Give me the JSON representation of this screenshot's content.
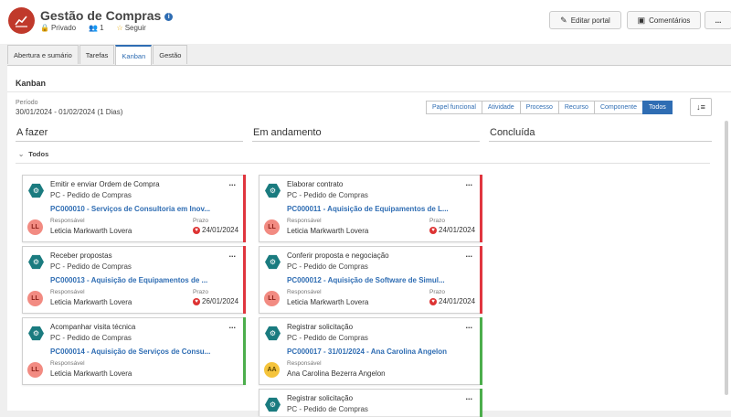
{
  "header": {
    "title": "Gestão de Compras",
    "privacy": "Privado",
    "members": "1",
    "follow": "Seguir",
    "edit_label": "Editar portal",
    "comments_label": "Comentários",
    "more_label": "...",
    "brand_color": "#c0392b"
  },
  "tabs": [
    {
      "label": "Abertura e sumário",
      "active": false
    },
    {
      "label": "Tarefas",
      "active": false
    },
    {
      "label": "Kanban",
      "active": true
    },
    {
      "label": "Gestão",
      "active": false
    }
  ],
  "kanban": {
    "title": "Kanban",
    "period_label": "Período",
    "period_value": "30/01/2024 - 01/02/2024 (1 Dias)",
    "filters": [
      "Papel funcional",
      "Atividade",
      "Processo",
      "Recurso",
      "Componente",
      "Todos"
    ],
    "active_filter": "Todos",
    "sort_icon": "sort-icon",
    "group": "Todos",
    "columns": [
      "A fazer",
      "Em andamento",
      "Concluída"
    ],
    "responsible_label": "Responsável",
    "due_label": "Prazo",
    "colors": {
      "late": "#e0363f",
      "ok": "#4cae4c",
      "accent": "#2f6db3",
      "icon": "#1a7b7f"
    },
    "cards": {
      "todo": [
        {
          "name": "Emitir e enviar Ordem de Compra",
          "type": "PC - Pedido de Compras",
          "link": "PC000010 - Serviços de Consultoria em Inov...",
          "initials": "LL",
          "responsible": "Leticia Markwarth Lovera",
          "due": "24/01/2024",
          "status": "late"
        },
        {
          "name": "Receber propostas",
          "type": "PC - Pedido de Compras",
          "link": "PC000013 - Aquisição de Equipamentos de ...",
          "initials": "LL",
          "responsible": "Leticia Markwarth Lovera",
          "due": "26/01/2024",
          "status": "late"
        },
        {
          "name": "Acompanhar visita técnica",
          "type": "PC - Pedido de Compras",
          "link": "PC000014 - Aquisição de Serviços de Consu...",
          "initials": "LL",
          "responsible": "Leticia Markwarth Lovera",
          "due": "",
          "status": "ok"
        }
      ],
      "doing": [
        {
          "name": "Elaborar contrato",
          "type": "PC - Pedido de Compras",
          "link": "PC000011 - Aquisição de Equipamentos de L...",
          "initials": "LL",
          "responsible": "Leticia Markwarth Lovera",
          "due": "24/01/2024",
          "status": "late"
        },
        {
          "name": "Conferir proposta e negociação",
          "type": "PC - Pedido de Compras",
          "link": "PC000012 - Aquisição de Software de Simul...",
          "initials": "LL",
          "responsible": "Leticia Markwarth Lovera",
          "due": "24/01/2024",
          "status": "late"
        },
        {
          "name": "Registrar solicitação",
          "type": "PC - Pedido de Compras",
          "link": "PC000017 - 31/01/2024 - Ana Carolina Angelon",
          "initials": "AA",
          "responsible": "Ana Carolina Bezerra Angelon",
          "due": "",
          "status": "ok"
        },
        {
          "name": "Registrar solicitação",
          "type": "PC - Pedido de Compras",
          "link": "",
          "initials": "",
          "responsible": "",
          "due": "",
          "status": "ok"
        }
      ]
    }
  }
}
